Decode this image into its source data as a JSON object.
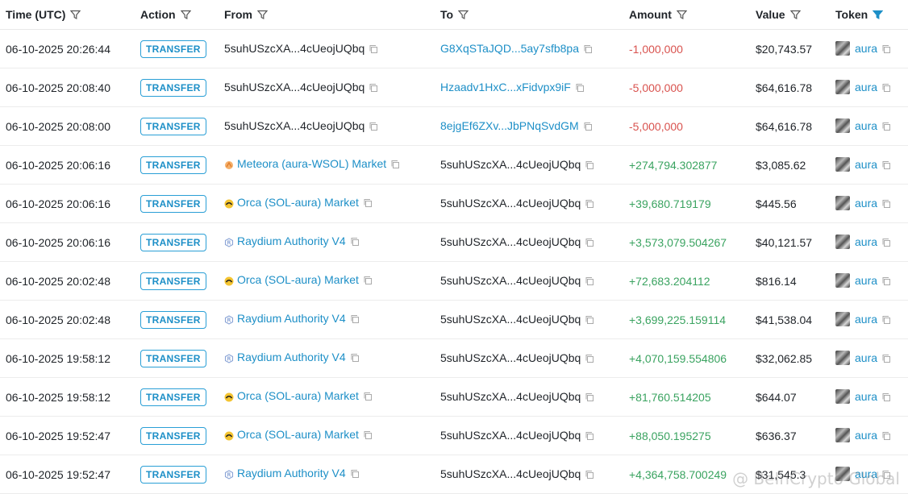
{
  "headers": {
    "time": "Time (UTC)",
    "action": "Action",
    "from": "From",
    "to": "To",
    "amount": "Amount",
    "value": "Value",
    "token": "Token"
  },
  "colors": {
    "link": "#1d8fc7",
    "negative": "#d9534f",
    "positive": "#3aa360",
    "filter_active": "#1d8fc7"
  },
  "rows": [
    {
      "time": "06-10-2025 20:26:44",
      "action": "TRANSFER",
      "from": "5suhUSzcXA...4cUeojUQbq",
      "from_icon": "",
      "to": "G8XqSTaJQD...5ay7sfb8pa",
      "to_link": true,
      "amount": "-1,000,000",
      "sign": "neg",
      "value": "$20,743.57",
      "token": "aura"
    },
    {
      "time": "06-10-2025 20:08:40",
      "action": "TRANSFER",
      "from": "5suhUSzcXA...4cUeojUQbq",
      "from_icon": "",
      "to": "Hzaadv1HxC...xFidvpx9iF",
      "to_link": true,
      "amount": "-5,000,000",
      "sign": "neg",
      "value": "$64,616.78",
      "token": "aura"
    },
    {
      "time": "06-10-2025 20:08:00",
      "action": "TRANSFER",
      "from": "5suhUSzcXA...4cUeojUQbq",
      "from_icon": "",
      "to": "8ejgEf6ZXv...JbPNqSvdGM",
      "to_link": true,
      "amount": "-5,000,000",
      "sign": "neg",
      "value": "$64,616.78",
      "token": "aura"
    },
    {
      "time": "06-10-2025 20:06:16",
      "action": "TRANSFER",
      "from": "Meteora (aura-WSOL) Market",
      "from_icon": "meteora",
      "to": "5suhUSzcXA...4cUeojUQbq",
      "to_link": false,
      "amount": "+274,794.302877",
      "sign": "pos",
      "value": "$3,085.62",
      "token": "aura"
    },
    {
      "time": "06-10-2025 20:06:16",
      "action": "TRANSFER",
      "from": "Orca (SOL-aura) Market",
      "from_icon": "orca",
      "to": "5suhUSzcXA...4cUeojUQbq",
      "to_link": false,
      "amount": "+39,680.719179",
      "sign": "pos",
      "value": "$445.56",
      "token": "aura"
    },
    {
      "time": "06-10-2025 20:06:16",
      "action": "TRANSFER",
      "from": "Raydium Authority V4",
      "from_icon": "raydium",
      "to": "5suhUSzcXA...4cUeojUQbq",
      "to_link": false,
      "amount": "+3,573,079.504267",
      "sign": "pos",
      "value": "$40,121.57",
      "token": "aura"
    },
    {
      "time": "06-10-2025 20:02:48",
      "action": "TRANSFER",
      "from": "Orca (SOL-aura) Market",
      "from_icon": "orca",
      "to": "5suhUSzcXA...4cUeojUQbq",
      "to_link": false,
      "amount": "+72,683.204112",
      "sign": "pos",
      "value": "$816.14",
      "token": "aura"
    },
    {
      "time": "06-10-2025 20:02:48",
      "action": "TRANSFER",
      "from": "Raydium Authority V4",
      "from_icon": "raydium",
      "to": "5suhUSzcXA...4cUeojUQbq",
      "to_link": false,
      "amount": "+3,699,225.159114",
      "sign": "pos",
      "value": "$41,538.04",
      "token": "aura"
    },
    {
      "time": "06-10-2025 19:58:12",
      "action": "TRANSFER",
      "from": "Raydium Authority V4",
      "from_icon": "raydium",
      "to": "5suhUSzcXA...4cUeojUQbq",
      "to_link": false,
      "amount": "+4,070,159.554806",
      "sign": "pos",
      "value": "$32,062.85",
      "token": "aura"
    },
    {
      "time": "06-10-2025 19:58:12",
      "action": "TRANSFER",
      "from": "Orca (SOL-aura) Market",
      "from_icon": "orca",
      "to": "5suhUSzcXA...4cUeojUQbq",
      "to_link": false,
      "amount": "+81,760.514205",
      "sign": "pos",
      "value": "$644.07",
      "token": "aura"
    },
    {
      "time": "06-10-2025 19:52:47",
      "action": "TRANSFER",
      "from": "Orca (SOL-aura) Market",
      "from_icon": "orca",
      "to": "5suhUSzcXA...4cUeojUQbq",
      "to_link": false,
      "amount": "+88,050.195275",
      "sign": "pos",
      "value": "$636.37",
      "token": "aura"
    },
    {
      "time": "06-10-2025 19:52:47",
      "action": "TRANSFER",
      "from": "Raydium Authority V4",
      "from_icon": "raydium",
      "to": "5suhUSzcXA...4cUeojUQbq",
      "to_link": false,
      "amount": "+4,364,758.700249",
      "sign": "pos",
      "value": "$31,545.3",
      "token": "aura"
    }
  ],
  "watermark": "@ BeInCrypto Global"
}
